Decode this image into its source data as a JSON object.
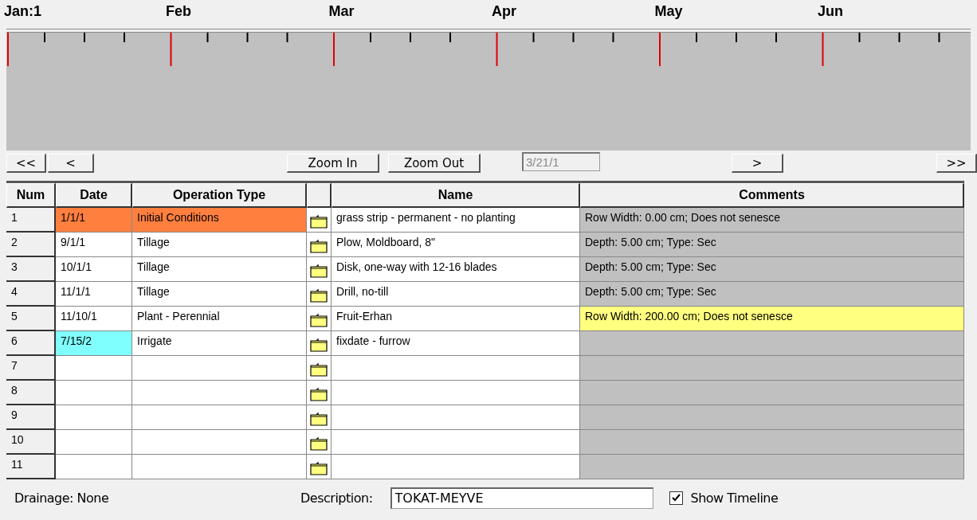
{
  "timeline": {
    "months": [
      "Jan:1",
      "Feb",
      "Mar",
      "Apr",
      "May",
      "Jun"
    ]
  },
  "nav": {
    "first": "<<",
    "prev": "<",
    "zoom_in": "Zoom In",
    "zoom_out": "Zoom Out",
    "date": "3/21/1",
    "next": ">",
    "last": ">>"
  },
  "table": {
    "columns": [
      "Num",
      "Date",
      "Operation Type",
      "",
      "Name",
      "Comments"
    ],
    "rows": [
      {
        "num": "1",
        "date": {
          "text": "1/1/1",
          "color": "#ff7f3f"
        },
        "operation": {
          "text": "Initial Conditions",
          "color": "#ff7f3f"
        },
        "name": "grass strip - permanent - no planting",
        "comments": {
          "text": "Row Width: 0.00 cm; Does not senesce",
          "color": "#c0c0c0"
        }
      },
      {
        "num": "2",
        "date": {
          "text": "9/1/1",
          "color": "#ffffff"
        },
        "operation": {
          "text": "Tillage",
          "color": "#ffffff"
        },
        "name": "Plow, Moldboard, 8\"",
        "comments": {
          "text": "Depth: 5.00 cm; Type: Sec",
          "color": "#c0c0c0"
        }
      },
      {
        "num": "3",
        "date": {
          "text": "10/1/1",
          "color": "#ffffff"
        },
        "operation": {
          "text": "Tillage",
          "color": "#ffffff"
        },
        "name": "Disk, one-way with 12-16 blades",
        "comments": {
          "text": "Depth: 5.00 cm; Type: Sec",
          "color": "#c0c0c0"
        }
      },
      {
        "num": "4",
        "date": {
          "text": "11/1/1",
          "color": "#ffffff"
        },
        "operation": {
          "text": "Tillage",
          "color": "#ffffff"
        },
        "name": "Drill, no-till",
        "comments": {
          "text": "Depth: 5.00 cm; Type: Sec",
          "color": "#c0c0c0"
        }
      },
      {
        "num": "5",
        "date": {
          "text": "11/10/1",
          "color": "#ffffff"
        },
        "operation": {
          "text": "Plant - Perennial",
          "color": "#ffffff"
        },
        "name": "Fruit-Erhan",
        "comments": {
          "text": "Row Width: 200.00 cm; Does not senesce",
          "color": "#ffff80"
        }
      },
      {
        "num": "6",
        "date": {
          "text": "7/15/2",
          "color": "#80ffff"
        },
        "operation": {
          "text": "Irrigate",
          "color": "#ffffff"
        },
        "name": "fixdate -  furrow",
        "comments": {
          "color": "#c0c0c0"
        }
      },
      {
        "num": "7"
      },
      {
        "num": "8"
      },
      {
        "num": "9"
      },
      {
        "num": "10"
      },
      {
        "num": "11"
      }
    ]
  },
  "footer": {
    "drainage": "Drainage: None",
    "description_label": "Description:",
    "description": "TOKAT-MEYVE",
    "show_timeline": {
      "label": "Show Timeline",
      "checked": true
    }
  }
}
